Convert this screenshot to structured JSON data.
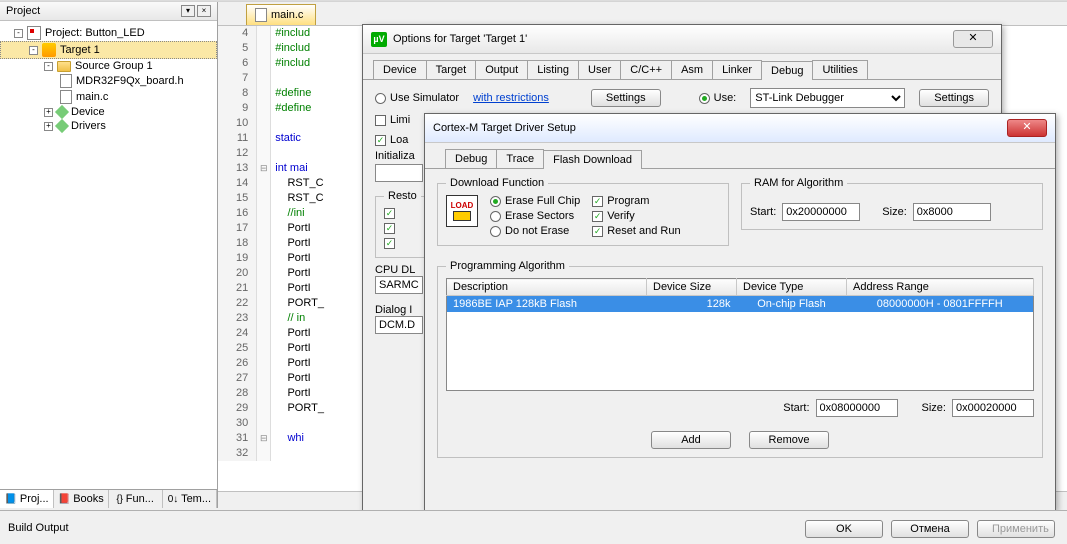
{
  "panel_title": "Project",
  "tree": {
    "root": "Project: Button_LED",
    "target": "Target 1",
    "group": "Source Group 1",
    "file1": "MDR32F9Qx_board.h",
    "file2": "main.c",
    "device": "Device",
    "drivers": "Drivers"
  },
  "sidebar_tabs": [
    "Proj...",
    "Books",
    "Fun...",
    "Tem..."
  ],
  "editor_tab": "main.c",
  "code_lines": [
    {
      "n": 4,
      "t": "#includ",
      "c": "kw-green"
    },
    {
      "n": 5,
      "t": "#includ",
      "c": "kw-green"
    },
    {
      "n": 6,
      "t": "#includ",
      "c": "kw-green"
    },
    {
      "n": 7,
      "t": "",
      "c": ""
    },
    {
      "n": 8,
      "t": "#define",
      "c": "kw-green"
    },
    {
      "n": 9,
      "t": "#define",
      "c": "kw-green"
    },
    {
      "n": 10,
      "t": "",
      "c": ""
    },
    {
      "n": 11,
      "t": "static ",
      "c": "kw-blue"
    },
    {
      "n": 12,
      "t": "",
      "c": ""
    },
    {
      "n": 13,
      "t": "int mai",
      "c": "kw-blue"
    },
    {
      "n": 14,
      "t": "    RST_C",
      "c": ""
    },
    {
      "n": 15,
      "t": "    RST_C",
      "c": ""
    },
    {
      "n": 16,
      "t": "    //ini",
      "c": "kw-comment"
    },
    {
      "n": 17,
      "t": "    PortI",
      "c": ""
    },
    {
      "n": 18,
      "t": "    PortI",
      "c": ""
    },
    {
      "n": 19,
      "t": "    PortI",
      "c": ""
    },
    {
      "n": 20,
      "t": "    PortI",
      "c": ""
    },
    {
      "n": 21,
      "t": "    PortI",
      "c": ""
    },
    {
      "n": 22,
      "t": "    PORT_",
      "c": ""
    },
    {
      "n": 23,
      "t": "    // in",
      "c": "kw-comment"
    },
    {
      "n": 24,
      "t": "    PortI",
      "c": ""
    },
    {
      "n": 25,
      "t": "    PortI",
      "c": ""
    },
    {
      "n": 26,
      "t": "    PortI",
      "c": ""
    },
    {
      "n": 27,
      "t": "    PortI",
      "c": ""
    },
    {
      "n": 28,
      "t": "    PortI",
      "c": ""
    },
    {
      "n": 29,
      "t": "    PORT_",
      "c": ""
    },
    {
      "n": 30,
      "t": "",
      "c": ""
    },
    {
      "n": 31,
      "t": "    whi",
      "c": "kw-blue"
    },
    {
      "n": 32,
      "t": "",
      "c": ""
    }
  ],
  "options_dialog": {
    "title": "Options for Target 'Target 1'",
    "tabs": [
      "Device",
      "Target",
      "Output",
      "Listing",
      "User",
      "C/C++",
      "Asm",
      "Linker",
      "Debug",
      "Utilities"
    ],
    "active_tab": "Debug",
    "use_simulator": "Use Simulator",
    "with_restrictions": "with restrictions",
    "settings": "Settings",
    "use": "Use:",
    "debugger": "ST-Link Debugger",
    "limit": "Limi",
    "load": "Loa",
    "init": "Initializa",
    "restore": "Resto",
    "cpu_dl": "CPU DL",
    "sarm": "SARMC",
    "dialog_dl": "Dialog I",
    "dcm": "DCM.D"
  },
  "driver_dialog": {
    "title": "Cortex-M Target Driver Setup",
    "tabs": [
      "Debug",
      "Trace",
      "Flash Download"
    ],
    "active_tab": "Flash Download",
    "download_function": "Download Function",
    "erase_full": "Erase Full Chip",
    "erase_sectors": "Erase Sectors",
    "do_not_erase": "Do not Erase",
    "program": "Program",
    "verify": "Verify",
    "reset_run": "Reset and Run",
    "ram_title": "RAM for Algorithm",
    "start": "Start:",
    "size": "Size:",
    "ram_start": "0x20000000",
    "ram_size": "0x8000",
    "prog_alg": "Programming Algorithm",
    "th_desc": "Description",
    "th_size": "Device Size",
    "th_type": "Device Type",
    "th_addr": "Address Range",
    "row_desc": "1986BE IAP 128kB Flash",
    "row_size": "128k",
    "row_type": "On-chip Flash",
    "row_addr": "08000000H - 0801FFFFH",
    "alg_start": "0x08000000",
    "alg_size": "0x00020000",
    "add": "Add",
    "remove": "Remove"
  },
  "build_output": "Build Output",
  "ok": "OK",
  "cancel": "Отмена",
  "apply": "Применить"
}
